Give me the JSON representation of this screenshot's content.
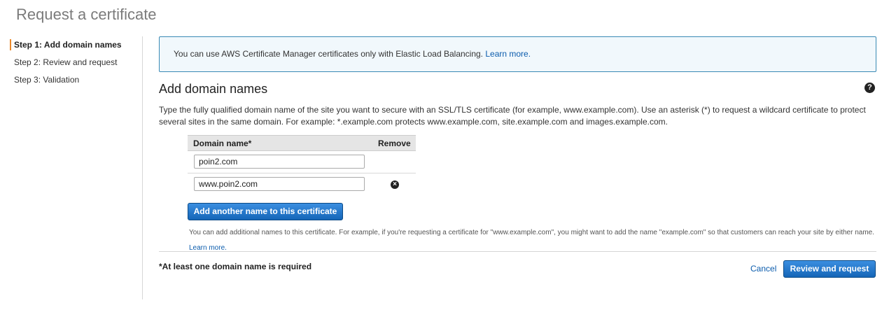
{
  "page": {
    "title": "Request a certificate"
  },
  "steps": [
    {
      "label": "Step 1: Add domain names",
      "active": true
    },
    {
      "label": "Step 2: Review and request",
      "active": false
    },
    {
      "label": "Step 3: Validation",
      "active": false
    }
  ],
  "info": {
    "text": "You can use AWS Certificate Manager certificates only with Elastic Load Balancing.",
    "link": "Learn more."
  },
  "section": {
    "title": "Add domain names",
    "help_icon": "?",
    "description": "Type the fully qualified domain name of the site you want to secure with an SSL/TLS certificate (for example, www.example.com). Use an asterisk (*) to request a wildcard certificate to protect several sites in the same domain. For example: *.example.com protects www.example.com, site.example.com and images.example.com."
  },
  "table": {
    "col_domain": "Domain name*",
    "col_remove": "Remove",
    "rows": [
      {
        "value": "poin2.com",
        "removable": false
      },
      {
        "value": "www.poin2.com",
        "removable": true
      }
    ],
    "remove_icon": "×"
  },
  "add_button": {
    "label": "Add another name to this certificate"
  },
  "hint": {
    "text": "You can add additional names to this certificate. For example, if you're requesting a certificate for \"www.example.com\", you might want to add the name \"example.com\" so that customers can reach your site by either name.",
    "link": "Learn more."
  },
  "footer": {
    "required_note": "*At least one domain name is required",
    "cancel": "Cancel",
    "submit": "Review and request"
  },
  "colors": {
    "accent": "#e9892d",
    "primary_button": "#1566b8",
    "link": "#0b5cad",
    "info_bg": "#f1f8fc",
    "info_border": "#3a8ab5"
  },
  "icons": {
    "help": "help-icon",
    "remove": "remove-icon"
  }
}
